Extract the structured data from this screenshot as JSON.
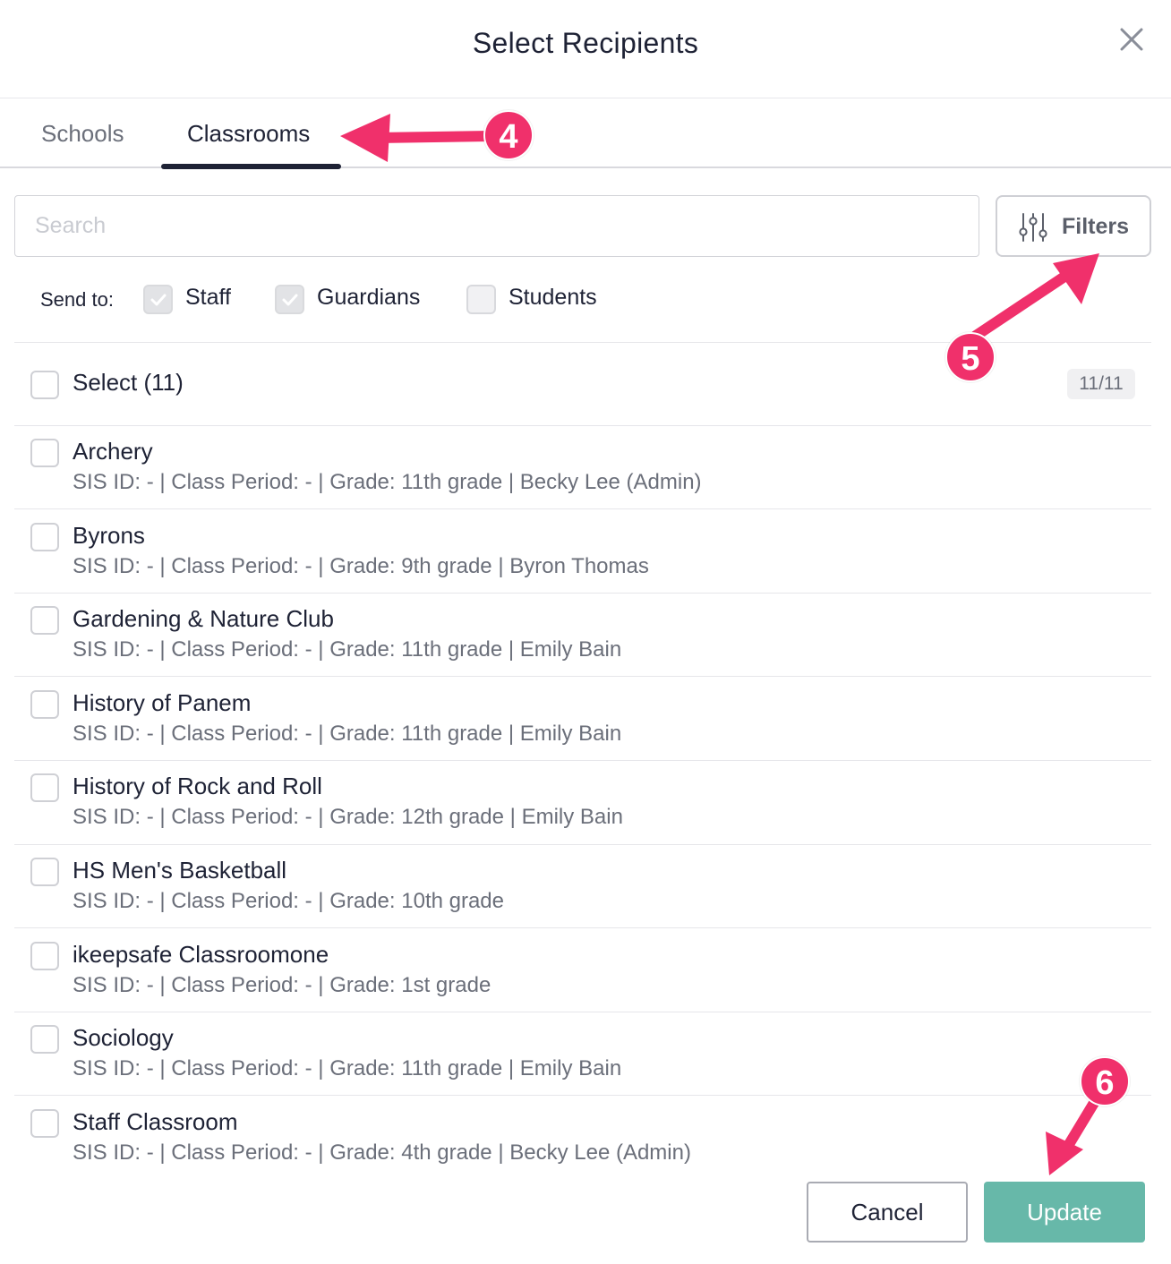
{
  "dialog": {
    "title": "Select Recipients"
  },
  "tabs": [
    {
      "label": "Schools",
      "active": false
    },
    {
      "label": "Classrooms",
      "active": true
    }
  ],
  "search": {
    "placeholder": "Search",
    "value": ""
  },
  "filters": {
    "label": "Filters"
  },
  "send_to": {
    "label": "Send to:",
    "options": [
      {
        "label": "Staff",
        "checked": true
      },
      {
        "label": "Guardians",
        "checked": true
      },
      {
        "label": "Students",
        "checked": false
      }
    ]
  },
  "select_all": {
    "label": "Select (11)",
    "count": "11/11"
  },
  "classrooms": [
    {
      "name": "Archery",
      "meta": "SIS ID: - | Class Period: - | Grade: 11th grade | Becky Lee (Admin)"
    },
    {
      "name": "Byrons",
      "meta": "SIS ID: - | Class Period: - | Grade: 9th grade | Byron Thomas"
    },
    {
      "name": "Gardening & Nature Club",
      "meta": "SIS ID: - | Class Period: - | Grade: 11th grade | Emily Bain"
    },
    {
      "name": "History of Panem",
      "meta": "SIS ID: - | Class Period: - | Grade: 11th grade | Emily Bain"
    },
    {
      "name": "History of Rock and Roll",
      "meta": "SIS ID: - | Class Period: - | Grade: 12th grade | Emily Bain"
    },
    {
      "name": "HS Men's Basketball",
      "meta": "SIS ID: - | Class Period: - | Grade: 10th grade"
    },
    {
      "name": "ikeepsafe Classroomone",
      "meta": "SIS ID: - | Class Period: - | Grade: 1st grade"
    },
    {
      "name": "Sociology",
      "meta": "SIS ID: - | Class Period: - | Grade: 11th grade | Emily Bain"
    },
    {
      "name": "Staff Classroom",
      "meta": "SIS ID: - | Class Period: - | Grade: 4th grade | Becky Lee (Admin)"
    }
  ],
  "footer": {
    "cancel_label": "Cancel",
    "update_label": "Update"
  },
  "annotations": [
    {
      "number": "4"
    },
    {
      "number": "5"
    },
    {
      "number": "6"
    }
  ],
  "colors": {
    "accent_update": "#67b8a9",
    "annotation": "#f0306b",
    "text_primary": "#1e2235",
    "text_secondary": "#6b6f7a"
  },
  "icons": {
    "close": "close-icon",
    "filters": "sliders-icon",
    "check": "check-icon"
  }
}
